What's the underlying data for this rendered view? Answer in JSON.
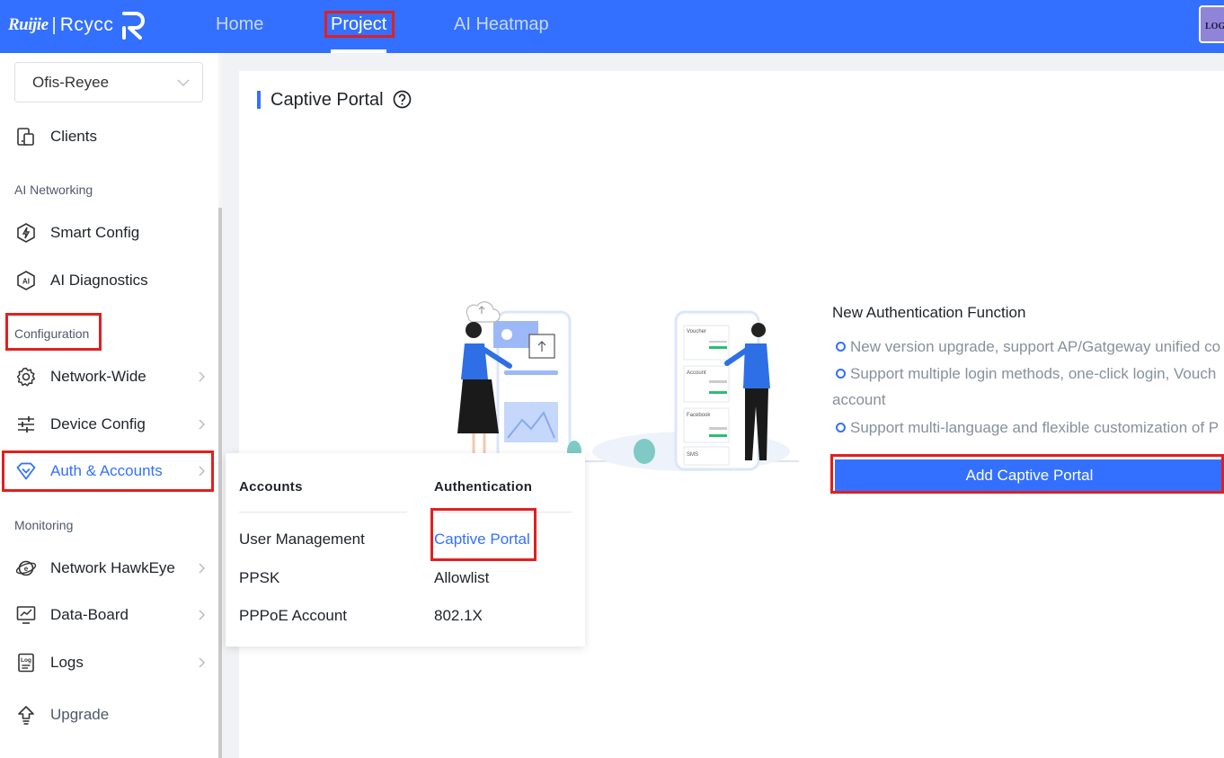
{
  "header": {
    "logo_brand": "Ruijie",
    "logo_separator": "|",
    "logo_sub": "Rcycc",
    "nav": [
      {
        "label": "Home"
      },
      {
        "label": "Project"
      },
      {
        "label": "AI Heatmap"
      }
    ],
    "avatar_text": "LOG"
  },
  "sidebar": {
    "project_select": "Ofis-Reyee",
    "clients": "Clients",
    "group_ai": "AI Networking",
    "smart_config": "Smart Config",
    "ai_diagnostics": "AI Diagnostics",
    "group_config": "Configuration",
    "network_wide": "Network-Wide",
    "device_config": "Device Config",
    "auth_accounts": "Auth & Accounts",
    "group_monitoring": "Monitoring",
    "hawkeye": "Network HawkEye",
    "data_board": "Data-Board",
    "logs": "Logs",
    "upgrade": "Upgrade"
  },
  "submenu": {
    "accounts_title": "Accounts",
    "authentication_title": "Authentication",
    "accounts_items": [
      "User Management",
      "PPSK",
      "PPPoE Account"
    ],
    "authentication_items": [
      "Captive Portal",
      "Allowlist",
      "802.1X"
    ]
  },
  "main": {
    "title": "Captive Portal",
    "info_title": "New Authentication Function",
    "info_lines": [
      "New version upgrade, support AP/Gatgeway unified co",
      "Support multiple login methods, one-click login, Vouch",
      "account",
      "Support multi-language and flexible customization of P"
    ],
    "add_button": "Add Captive Portal",
    "illustration_labels": [
      "Voucher",
      "Account",
      "Facebook",
      "SMS"
    ]
  },
  "colors": {
    "primary": "#3370ff",
    "highlight_box": "#e02020"
  }
}
